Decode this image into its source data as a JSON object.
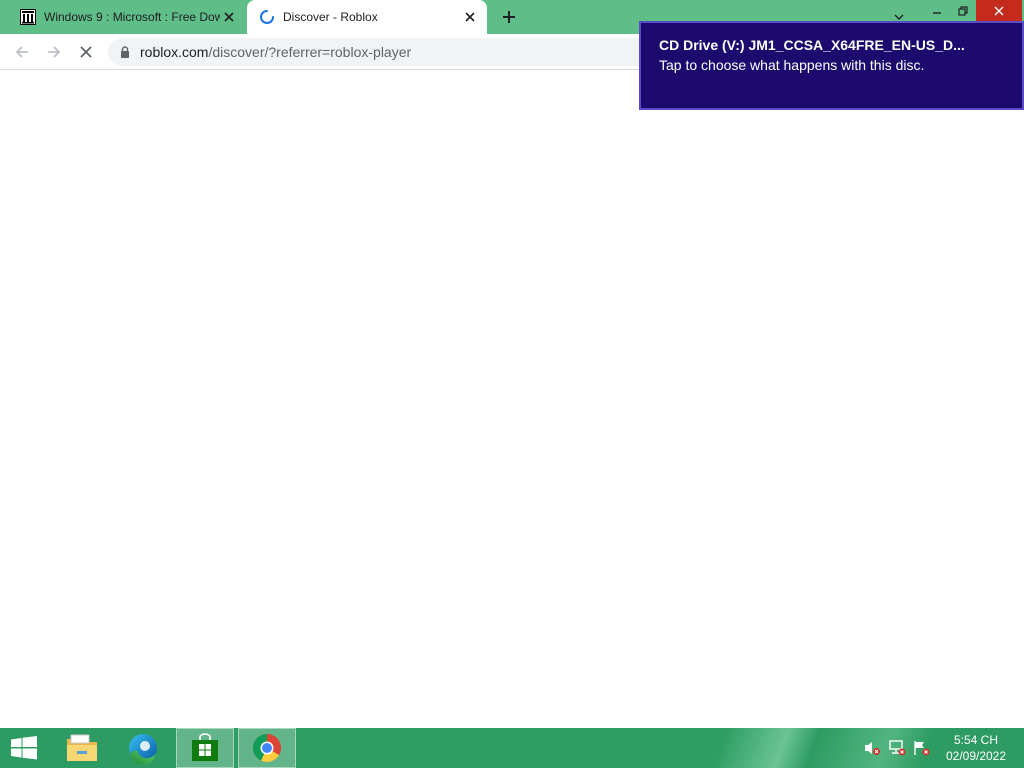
{
  "browser": {
    "tabs": [
      {
        "title": "Windows 9 : Microsoft : Free Dow",
        "favicon": "archive-icon",
        "active": false
      },
      {
        "title": "Discover - Roblox",
        "favicon": "loading-spinner-icon",
        "active": true
      }
    ],
    "address_bar": {
      "host": "roblox.com",
      "path": "/discover/?referrer=roblox-player"
    },
    "colors": {
      "frame": "#5fbd88",
      "toolbar": "#ffffff",
      "omnibox": "#f1f3f4"
    }
  },
  "notification": {
    "title": "CD Drive (V:) JM1_CCSA_X64FRE_EN-US_D...",
    "body": "Tap to choose what happens with this disc.",
    "background": "#1c0a6e"
  },
  "taskbar": {
    "items": [
      "start-icon",
      "file-explorer-icon",
      "edge-icon",
      "store-icon",
      "chrome-icon"
    ],
    "active_item": "chrome-icon",
    "tray": [
      "volume-muted-icon",
      "network-error-icon",
      "action-center-flag-icon"
    ],
    "time": "5:54 CH",
    "date": "02/09/2022",
    "color": "#2e9c62"
  }
}
